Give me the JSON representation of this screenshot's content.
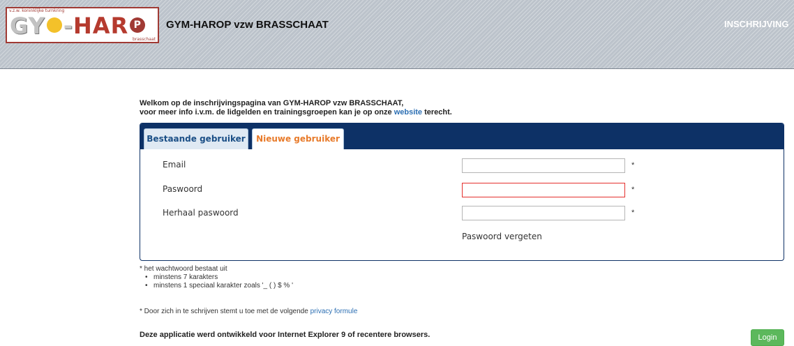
{
  "header": {
    "logo": {
      "top_text": "v.z.w. koninklijke turnkring",
      "main_text": "GYM-HAROP",
      "bottom_text": "brasschaat"
    },
    "title": "GYM-HAROP vzw BRASSCHAAT",
    "right_text": "INSCHRIJVING"
  },
  "intro": {
    "line1": "Welkom op de inschrijvingspagina van GYM-HAROP vzw BRASSCHAAT,",
    "line2_before": "voor meer info i.v.m. de lidgelden en trainingsgroepen kan je op onze ",
    "line2_link": "website",
    "line2_after": " terecht."
  },
  "tabs": [
    {
      "label": "Bestaande gebruiker",
      "active": false
    },
    {
      "label": "Nieuwe gebruiker",
      "active": true
    }
  ],
  "form": {
    "email": {
      "label": "Email",
      "value": "",
      "required_mark": "*"
    },
    "password": {
      "label": "Paswoord",
      "value": "",
      "required_mark": "*",
      "state": "error"
    },
    "repeat_password": {
      "label": "Herhaal paswoord",
      "value": "",
      "required_mark": "*"
    },
    "forgot_link": "Paswoord vergeten"
  },
  "notes": {
    "intro": "* het wachtwoord bestaat uit",
    "rules": [
      "minstens 7 karakters",
      "minstens 1 speciaal karakter zoals '_ ( ) $ % '"
    ]
  },
  "privacy": {
    "text": "* Door zich in te schrijven stemt u toe met de volgende ",
    "link": "privacy formule"
  },
  "browser_note": "Deze applicatie werd ontwikkeld voor Internet Explorer 9 of recentere browsers.",
  "login_button": "Login",
  "colors": {
    "navy": "#0d3166",
    "active_tab_text": "#e87b2b",
    "link": "#2c6fb3",
    "error_border": "#e5302d",
    "login_green": "#5cb85c"
  }
}
